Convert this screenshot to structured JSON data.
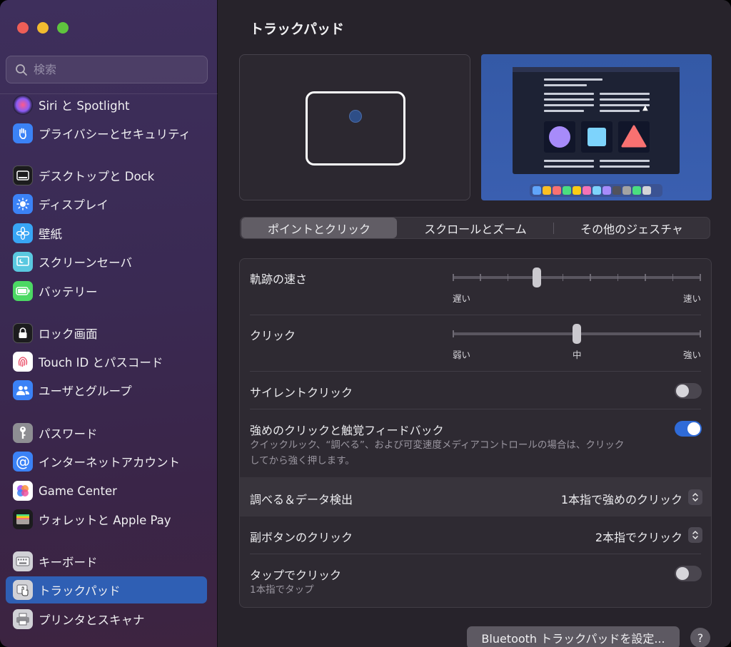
{
  "window": {
    "title": "トラックパッド"
  },
  "search": {
    "placeholder": "検索"
  },
  "sidebar": {
    "items": [
      {
        "label": "Siri と Spotlight",
        "icon": "siri-icon"
      },
      {
        "label": "プライバシーとセキュリティ",
        "icon": "hand-icon"
      },
      {
        "label": "デスクトップと Dock",
        "icon": "dock-icon"
      },
      {
        "label": "ディスプレイ",
        "icon": "display-brightness-icon"
      },
      {
        "label": "壁紙",
        "icon": "wallpaper-flower-icon"
      },
      {
        "label": "スクリーンセーバ",
        "icon": "screensaver-icon"
      },
      {
        "label": "バッテリー",
        "icon": "battery-icon"
      },
      {
        "label": "ロック画面",
        "icon": "lock-icon"
      },
      {
        "label": "Touch ID とパスコード",
        "icon": "fingerprint-icon"
      },
      {
        "label": "ユーザとグループ",
        "icon": "users-icon"
      },
      {
        "label": "パスワード",
        "icon": "key-icon"
      },
      {
        "label": "インターネットアカウント",
        "icon": "at-sign-icon"
      },
      {
        "label": "Game Center",
        "icon": "game-center-icon"
      },
      {
        "label": "ウォレットと Apple Pay",
        "icon": "wallet-icon"
      },
      {
        "label": "キーボード",
        "icon": "keyboard-icon"
      },
      {
        "label": "トラックパッド",
        "icon": "trackpad-icon",
        "selected": true
      },
      {
        "label": "プリンタとスキャナ",
        "icon": "printer-icon"
      }
    ]
  },
  "tabs": [
    {
      "label": "ポイントとクリック",
      "selected": true
    },
    {
      "label": "スクロールとズーム"
    },
    {
      "label": "その他のジェスチャ"
    }
  ],
  "settings": {
    "tracking_speed": {
      "label": "軌跡の速さ",
      "min_label": "遅い",
      "max_label": "速い",
      "value": 0.33,
      "ticks": 10
    },
    "click": {
      "label": "クリック",
      "min_label": "弱い",
      "mid_label": "中",
      "max_label": "強い",
      "value": 0.5,
      "ticks": 3
    },
    "silent_click": {
      "label": "サイレントクリック",
      "on": false
    },
    "force_click": {
      "label": "強めのクリックと触覚フィードバック",
      "on": true,
      "description_line1": "クイックルック、“調べる”、および可変速度メディアコントロールの場合は、クリック",
      "description_line2": "してから強く押します。"
    },
    "lookup": {
      "label": "調べる＆データ検出",
      "value": "1本指で強めのクリック"
    },
    "secondary_click": {
      "label": "副ボタンのクリック",
      "value": "2本指でクリック"
    },
    "tap_to_click": {
      "label": "タップでクリック",
      "sublabel": "1本指でタップ",
      "on": false
    }
  },
  "buttons": {
    "bluetooth": "Bluetooth トラックパッドを設定...",
    "help": "?"
  },
  "colors": {
    "accent": "#2f6bd8",
    "sidebar_selected": "#2f5fb4"
  }
}
